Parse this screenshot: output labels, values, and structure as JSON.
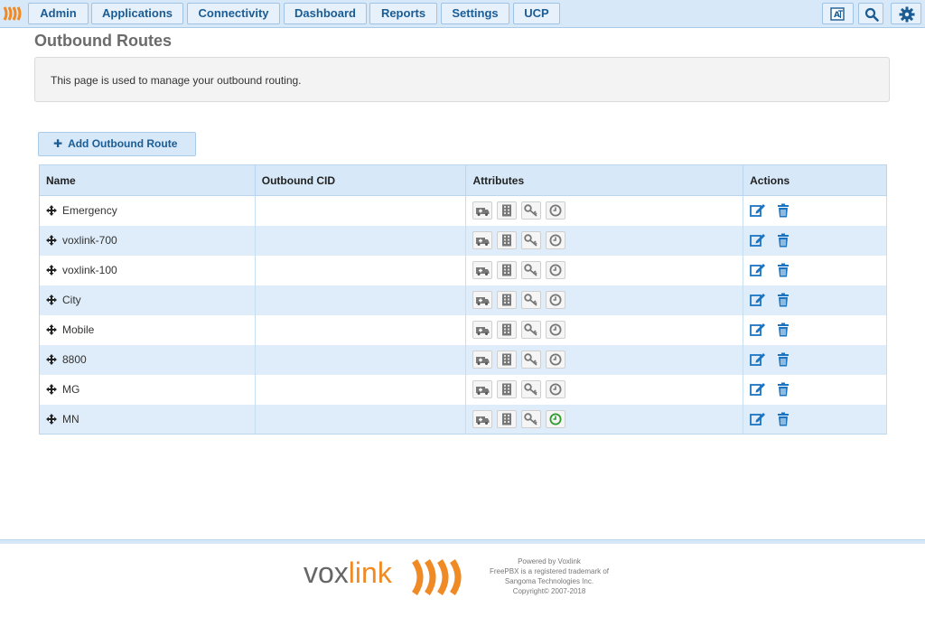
{
  "nav": {
    "items": [
      "Admin",
      "Applications",
      "Connectivity",
      "Dashboard",
      "Reports",
      "Settings",
      "UCP"
    ]
  },
  "page": {
    "title": "Outbound Routes",
    "info": "This page is used to manage your outbound routing.",
    "add_button": "Add Outbound Route"
  },
  "table": {
    "headers": [
      "Name",
      "Outbound CID",
      "Attributes",
      "Actions"
    ],
    "rows": [
      {
        "name": "Emergency",
        "cid": "",
        "time_active": false
      },
      {
        "name": "voxlink-700",
        "cid": "",
        "time_active": false
      },
      {
        "name": "voxlink-100",
        "cid": "",
        "time_active": false
      },
      {
        "name": "City",
        "cid": "",
        "time_active": false
      },
      {
        "name": "Mobile",
        "cid": "",
        "time_active": false
      },
      {
        "name": "8800",
        "cid": "",
        "time_active": false
      },
      {
        "name": "MG",
        "cid": "",
        "time_active": false
      },
      {
        "name": "MN",
        "cid": "",
        "time_active": true
      }
    ],
    "attribute_icons": [
      "emergency-icon",
      "building-icon",
      "key-icon",
      "clock-icon"
    ]
  },
  "footer": {
    "brand_a": "vox",
    "brand_b": "link",
    "lines": [
      "Powered by Voxlink",
      "FreePBX is a registered trademark of",
      "Sangoma Technologies Inc.",
      "Copyright© 2007-2018"
    ]
  },
  "colors": {
    "accent": "#1b5c94",
    "brand_orange": "#f08a24",
    "active_green": "#2a9a2a",
    "header_bg": "#d7e9f8"
  }
}
